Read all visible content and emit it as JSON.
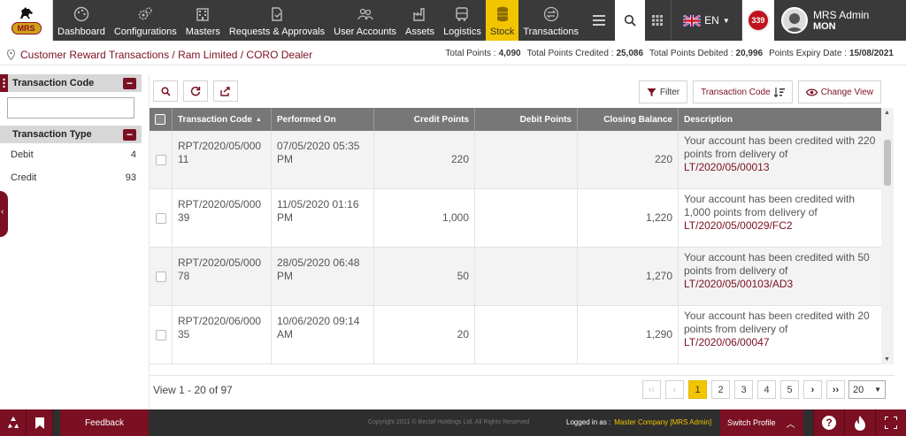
{
  "nav": {
    "logo_text": "MRS",
    "items": [
      {
        "label": "Dashboard",
        "icon": "palette-icon"
      },
      {
        "label": "Configurations",
        "icon": "gears-icon"
      },
      {
        "label": "Masters",
        "icon": "building-icon"
      },
      {
        "label": "Requests & Approvals",
        "icon": "document-check-icon"
      },
      {
        "label": "User Accounts",
        "icon": "users-icon"
      },
      {
        "label": "Assets",
        "icon": "factory-icon"
      },
      {
        "label": "Logistics",
        "icon": "truck-icon"
      },
      {
        "label": "Stock",
        "icon": "coins-icon"
      },
      {
        "label": "Transactions",
        "icon": "exchange-icon"
      }
    ],
    "active": "Stock",
    "language": "EN",
    "notification_count": "339",
    "user_name": "MRS Admin",
    "user_sub": "MON"
  },
  "breadcrumb": "Customer Reward Transactions / Ram Limited / CORO Dealer",
  "stats": [
    {
      "label": "Total Points :",
      "value": "4,090"
    },
    {
      "label": "Total Points Credited :",
      "value": "25,086"
    },
    {
      "label": "Total Points Debited :",
      "value": "20,996"
    },
    {
      "label": "Points Expiry Date :",
      "value": "15/08/2021"
    }
  ],
  "filters": {
    "transaction_code_title": "Transaction Code",
    "transaction_code_value": "",
    "transaction_type_title": "Transaction Type",
    "types": [
      {
        "label": "Debit",
        "count": "4"
      },
      {
        "label": "Credit",
        "count": "93"
      }
    ]
  },
  "toolbar": {
    "filter_label": "Filter",
    "sort_label": "Transaction Code",
    "change_view_label": "Change View"
  },
  "table": {
    "columns": [
      "Transaction Code",
      "Performed On",
      "Credit Points",
      "Debit Points",
      "Closing Balance",
      "Description"
    ],
    "rows": [
      {
        "code": "RPT/2020/05/000 11",
        "date": "07/05/2020 05:35 PM",
        "credit": "220",
        "debit": "",
        "balance": "220",
        "desc": "Your account has been credited with 220 points from delivery of",
        "ref": "LT/2020/05/00013"
      },
      {
        "code": "RPT/2020/05/000 39",
        "date": "11/05/2020 01:16 PM",
        "credit": "1,000",
        "debit": "",
        "balance": "1,220",
        "desc": "Your account has been credited with 1,000 points from delivery of",
        "ref": "LT/2020/05/00029/FC2"
      },
      {
        "code": "RPT/2020/05/000 78",
        "date": "28/05/2020 06:48 PM",
        "credit": "50",
        "debit": "",
        "balance": "1,270",
        "desc": "Your account has been credited with 50 points from delivery of",
        "ref": "LT/2020/05/00103/AD3"
      },
      {
        "code": "RPT/2020/06/000 35",
        "date": "10/06/2020 09:14 AM",
        "credit": "20",
        "debit": "",
        "balance": "1,290",
        "desc": "Your account has been credited with 20 points from delivery of",
        "ref": "LT/2020/06/00047"
      }
    ]
  },
  "pager": {
    "info": "View 1 - 20 of 97",
    "first": "‹‹",
    "prev": "‹",
    "pages": [
      "1",
      "2",
      "3",
      "4",
      "5"
    ],
    "current": "1",
    "next": "›",
    "last": "››",
    "per_page": "20"
  },
  "footer": {
    "feedback": "Feedback",
    "copyright": "Copyright 2021 © Bectaf Holdings Ltd. All Rights Reserved",
    "logged_label": "Logged in as :",
    "logged_value": "Master Company [MRS Admin]",
    "switch_profile": "Switch Profile"
  },
  "colors": {
    "brand": "#7a1022",
    "accent": "#f2c500",
    "nav_bg": "#3a3a3a",
    "header_bg": "#777777"
  }
}
